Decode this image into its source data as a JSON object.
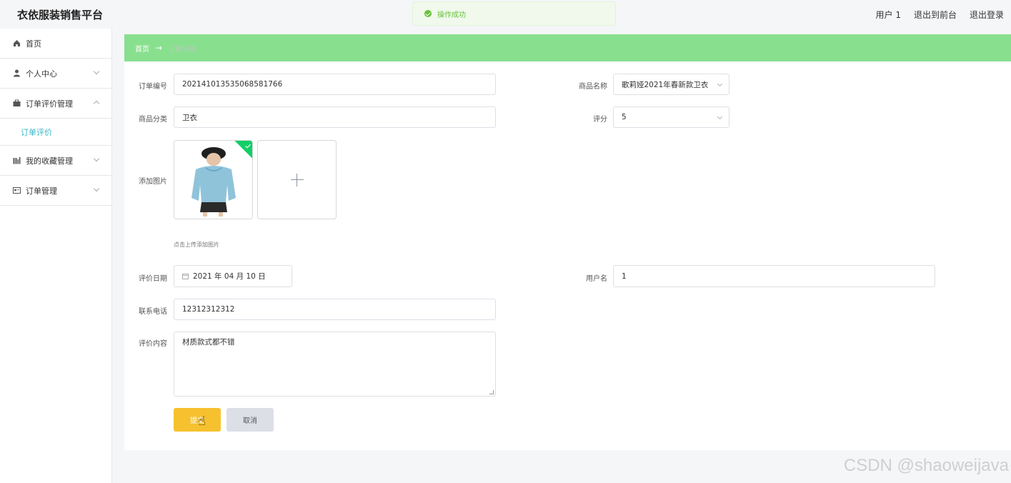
{
  "app": {
    "title": "衣依服装销售平台",
    "user_label": "用户 1",
    "back_front_label": "退出到前台",
    "logout_label": "退出登录"
  },
  "toast": {
    "message": "操作成功",
    "color": "#67c23a"
  },
  "sidebar": {
    "items": [
      {
        "label": "首页",
        "icon": "home-icon"
      },
      {
        "label": "个人中心",
        "icon": "user-icon"
      },
      {
        "label": "订单评价管理",
        "icon": "briefcase-icon"
      },
      {
        "label": "我的收藏管理",
        "icon": "bar-chart-icon"
      },
      {
        "label": "订单管理",
        "icon": "card-icon"
      }
    ],
    "active_sub": "订单评价"
  },
  "breadcrumb": {
    "home": "首页",
    "arrow": "→",
    "current": "订单评价",
    "bg": "#88e08e"
  },
  "form": {
    "order_no_label": "订单编号",
    "order_no_value": "202141013535068581766",
    "product_name_label": "商品名称",
    "product_name_value": "歌莉娅2021年春新款卫衣",
    "category_label": "商品分类",
    "category_value": "卫衣",
    "rating_label": "评分",
    "rating_value": "5",
    "image_label": "添加图片",
    "upload_tip": "点击上传添加图片",
    "date_label": "评价日期",
    "date_value": "2021 年 04 月 10 日",
    "username_label": "用户名",
    "username_value": "1",
    "phone_label": "联系电话",
    "phone_value": "12312312312",
    "content_label": "评价内容",
    "content_value": "材质款式都不错",
    "submit_label": "提交",
    "cancel_label": "取消",
    "submit_color": "#f6c12e"
  },
  "watermark": "CSDN @shaoweijava"
}
